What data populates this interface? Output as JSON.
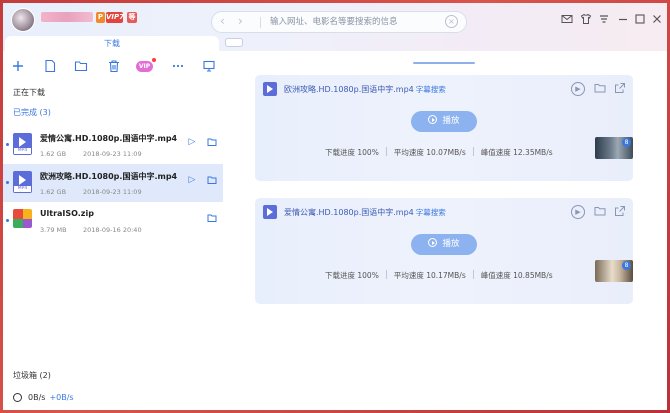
{
  "header": {
    "badges": {
      "p": "P",
      "vip": "VIP7",
      "level": "等"
    },
    "nav": {
      "back_icon": "chevron-left-icon",
      "forward_icon": "chevron-right-icon"
    },
    "search": {
      "placeholder": "输入网址、电影名等要搜索的信息"
    },
    "window_controls": [
      "mail-icon",
      "shirt-icon",
      "menu-icon",
      "minimize-icon",
      "maximize-icon",
      "close-icon"
    ]
  },
  "tabs": {
    "main": "下载"
  },
  "toolbar": {
    "icons": [
      "plus-icon",
      "new-file-icon",
      "folder-icon",
      "delete-icon",
      "vip-icon",
      "more-icon",
      "screen-icon"
    ],
    "vip_label": "VIP"
  },
  "sidebar": {
    "downloading_label": "正在下载",
    "completed_label": "已完成 (3)",
    "items": [
      {
        "name": "爱情公寓.HD.1080p.国语中字.mp4",
        "size": "1.62 GB",
        "date": "2018-09-23 11:09",
        "type": "video",
        "tag": "MP4"
      },
      {
        "name": "欧洲攻略.HD.1080p.国语中字.mp4",
        "size": "1.62 GB",
        "date": "2018-09-23 11:09",
        "type": "video",
        "tag": "MP4"
      },
      {
        "name": "UltraISO.zip",
        "size": "3.79 MB",
        "date": "2018-09-16 20:40",
        "type": "zip"
      }
    ],
    "trash_label": "垃圾箱 (2)",
    "speed_down": "0B/s",
    "speed_up": "+0B/s"
  },
  "cards": [
    {
      "title": "欧洲攻略.HD.1080p.国语中字.mp4",
      "subtitle": "字幕搜索",
      "play_label": "播放",
      "progress_text": "下载进度 100%",
      "avg_speed": "平均速度 10.07MB/s",
      "peak_speed": "峰值速度 12.35MB/s",
      "thumb_badge": "8"
    },
    {
      "title": "爱情公寓.HD.1080p.国语中字.mp4",
      "subtitle": "字幕搜索",
      "play_label": "播放",
      "progress_text": "下载进度 100%",
      "avg_speed": "平均速度 10.17MB/s",
      "peak_speed": "峰值速度 10.85MB/s",
      "thumb_badge": "8"
    }
  ],
  "colors": {
    "accent": "#3a78e0",
    "selected_bg": "#dfe9fb",
    "play_button": "#8db2f0",
    "file_icon": "#5c6cd8"
  }
}
